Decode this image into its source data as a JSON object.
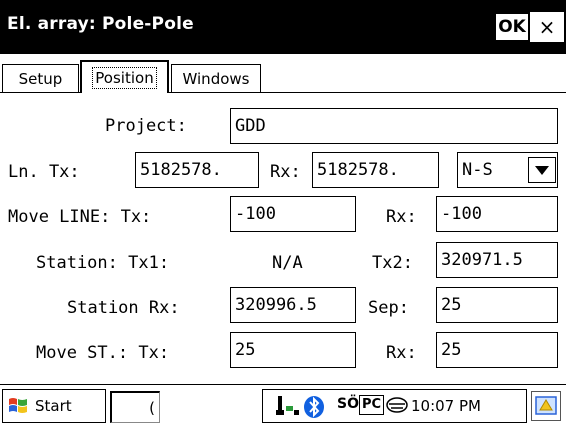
{
  "window": {
    "title": "El. array: Pole-Pole",
    "ok_label": "OK",
    "close_label": "×"
  },
  "tabs": [
    {
      "label": "Setup"
    },
    {
      "label": "Position"
    },
    {
      "label": "Windows"
    }
  ],
  "form": {
    "project_label": "Project:",
    "project_value": "GDD",
    "ln_tx_label": "Ln. Tx:",
    "ln_tx_value": "5182578.",
    "rx_label": "Rx:",
    "rx_value": "5182578.",
    "direction_value": "N-S",
    "move_line_label": "Move LINE: Tx:",
    "move_line_tx_value": "-100",
    "move_line_rx_label": "Rx:",
    "move_line_rx_value": "-100",
    "station_label": "Station: Tx1:",
    "station_tx1_value": "N/A",
    "tx2_label": "Tx2:",
    "tx2_value": "320971.5",
    "station_rx_label": "Station Rx:",
    "station_rx_value": "320996.5",
    "sep_label": "Sep:",
    "sep_value": "25",
    "move_st_label": "Move ST.: Tx:",
    "move_st_tx_value": "25",
    "move_st_rx_label": "Rx:",
    "move_st_rx_value": "25"
  },
  "taskbar": {
    "start_label": "Start",
    "app_label": "(",
    "tray_so": "SÖ",
    "tray_pc": "PC",
    "clock": "10:07 PM"
  },
  "colors": {
    "titlebar_bg": "#000000",
    "background": "#ffffff",
    "bluetooth": "#1060e0"
  }
}
